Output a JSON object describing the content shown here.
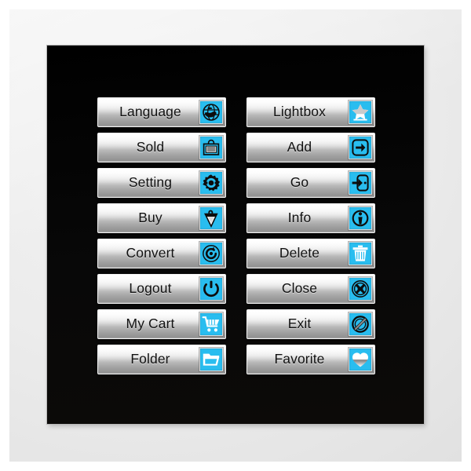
{
  "theme": {
    "panel_bg": "#060606",
    "canvas_bg": "#ececec",
    "accent": "#29bdef",
    "button_face_light": "#ffffff",
    "button_face_dark": "#8f8f8f",
    "label_color": "#121212"
  },
  "panel": {
    "columns": [
      {
        "name": "left-column",
        "buttons": [
          {
            "label": "Language",
            "icon": "globe-icon"
          },
          {
            "label": "Sold",
            "icon": "shopping-bag-icon"
          },
          {
            "label": "Setting",
            "icon": "gear-icon"
          },
          {
            "label": "Buy",
            "icon": "price-tag-icon"
          },
          {
            "label": "Convert",
            "icon": "refresh-circle-icon"
          },
          {
            "label": "Logout",
            "icon": "power-icon"
          },
          {
            "label": "My Cart",
            "icon": "shopping-cart-icon"
          },
          {
            "label": "Folder",
            "icon": "folder-icon"
          }
        ]
      },
      {
        "name": "right-column",
        "buttons": [
          {
            "label": "Lightbox",
            "icon": "star-upload-icon"
          },
          {
            "label": "Add",
            "icon": "add-box-icon"
          },
          {
            "label": "Go",
            "icon": "door-enter-icon"
          },
          {
            "label": "Info",
            "icon": "info-circle-icon"
          },
          {
            "label": "Delete",
            "icon": "trash-icon"
          },
          {
            "label": "Close",
            "icon": "close-circle-icon"
          },
          {
            "label": "Exit",
            "icon": "no-entry-icon"
          },
          {
            "label": "Favorite",
            "icon": "heart-icon"
          }
        ]
      }
    ]
  }
}
